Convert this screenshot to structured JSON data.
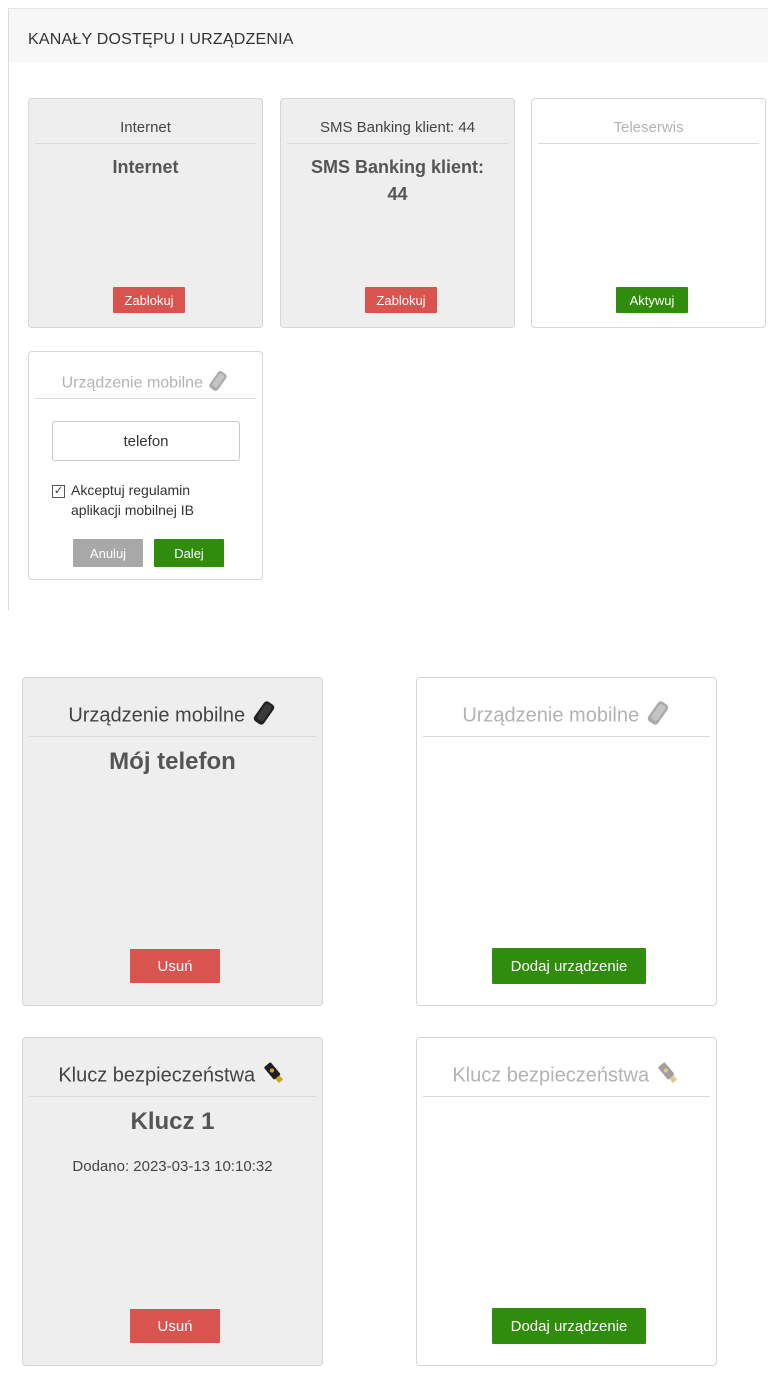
{
  "section": {
    "title": "KANAŁY DOSTĘPU I URZĄDZENIA"
  },
  "channels": [
    {
      "header": "Internet",
      "value": "Internet",
      "button": "Zablokuj"
    },
    {
      "header": "SMS Banking klient: 44",
      "value_line1": "SMS Banking klient:",
      "value_line2": "44",
      "button": "Zablokuj"
    },
    {
      "header": "Teleserwis",
      "value": "",
      "button": "Aktywuj"
    }
  ],
  "mobile_form": {
    "header": "Urządzenie mobilne",
    "input_value": "telefon",
    "checkbox_mark": "✓",
    "checkbox_label_line1": "Akceptuj regulamin",
    "checkbox_label_line2": "aplikacji mobilnej IB",
    "cancel_label": "Anuluj",
    "next_label": "Dalej"
  },
  "devices": [
    {
      "header": "Urządzenie mobilne",
      "value": "Mój telefon",
      "button": "Usuń",
      "icon": "phone-icon"
    },
    {
      "header": "Urządzenie mobilne",
      "value": "",
      "button": "Dodaj urządzenie",
      "icon": "phone-icon"
    },
    {
      "header": "Klucz bezpieczeństwa",
      "value": "Klucz 1",
      "added": "Dodano: 2023-03-13 10:10:32",
      "button": "Usuń",
      "icon": "usb-key-icon"
    },
    {
      "header": "Klucz bezpieczeństwa",
      "value": "",
      "button": "Dodaj urządzenie",
      "icon": "usb-key-icon"
    }
  ],
  "colors": {
    "danger": "#d9534f",
    "success": "#2f8c0c",
    "neutral": "#a8a8a8",
    "card_active": "#eeeeee",
    "card_inactive": "#ffffff"
  }
}
